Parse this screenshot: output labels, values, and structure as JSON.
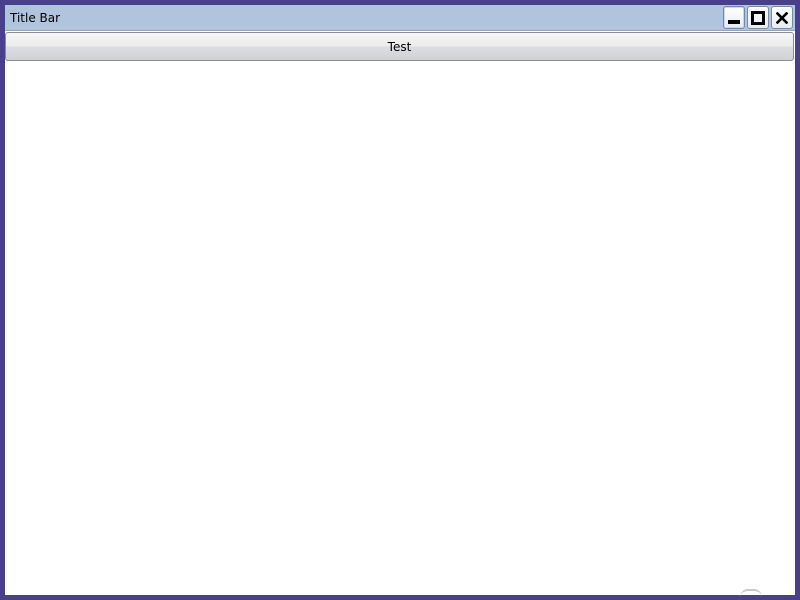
{
  "window": {
    "title": "Title Bar",
    "controls": {
      "minimize_icon": "minimize-icon",
      "maximize_icon": "maximize-icon",
      "close_icon": "close-icon",
      "close_glyph": "✕"
    }
  },
  "toolbar": {
    "test_label": "Test"
  },
  "colors": {
    "frame": "#4a3f8a",
    "titlebar": "#b0c4de",
    "content": "#ffffff"
  }
}
